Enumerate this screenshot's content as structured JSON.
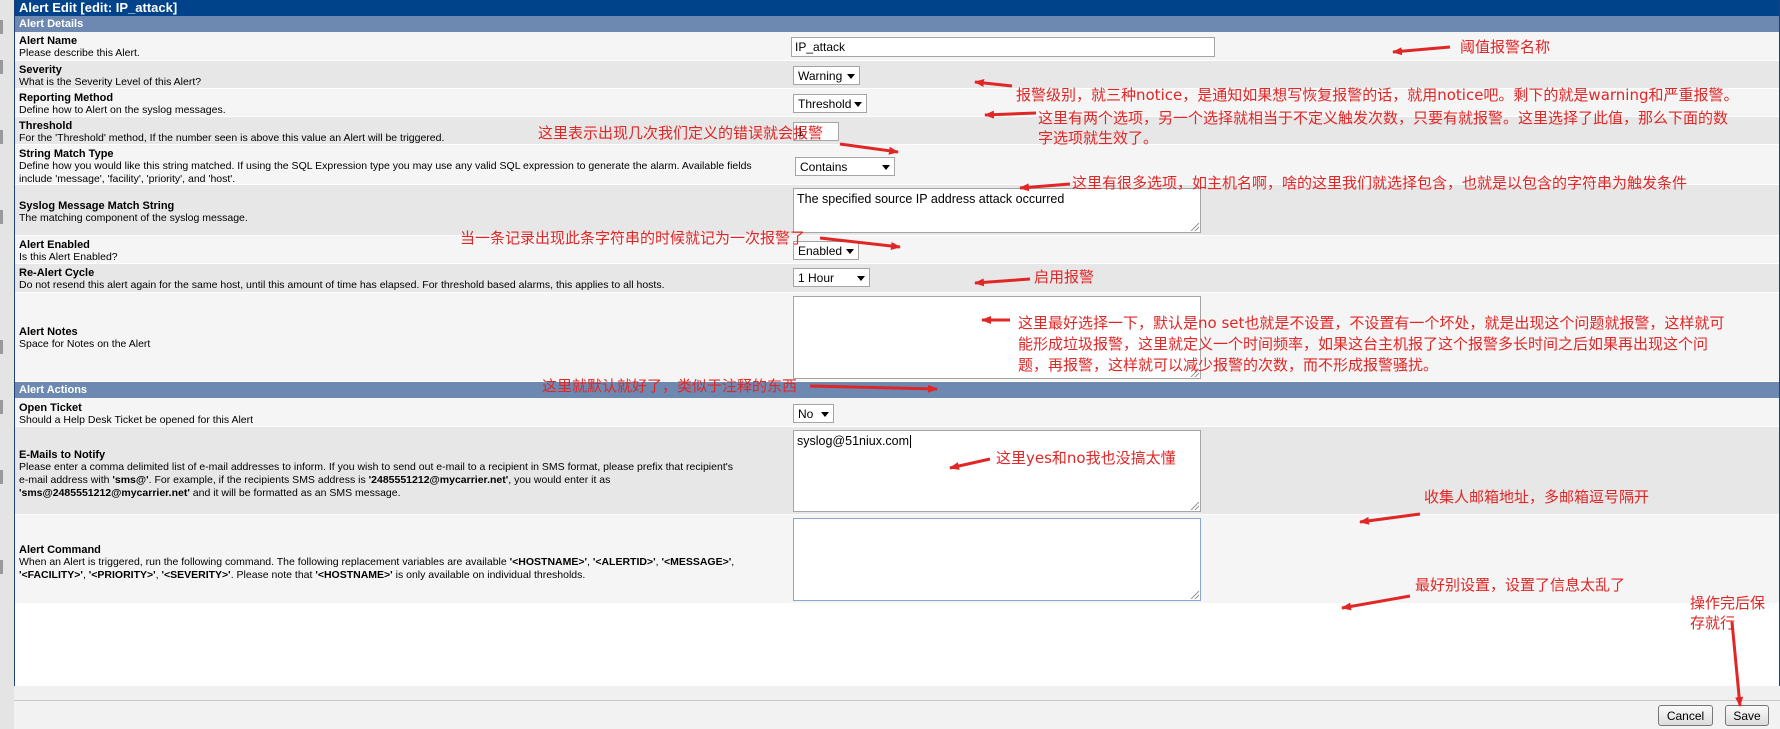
{
  "window": {
    "title": "Alert Edit [edit: IP_attack]"
  },
  "sections": {
    "details": "Alert Details",
    "actions": "Alert Actions"
  },
  "fields": {
    "alert_name": {
      "label": "Alert Name",
      "desc": "Please describe this Alert.",
      "value": "IP_attack"
    },
    "severity": {
      "label": "Severity",
      "desc": "What is the Severity Level of this Alert?",
      "value": "Warning"
    },
    "reporting": {
      "label": "Reporting Method",
      "desc": "Define how to Alert on the syslog messages.",
      "value": "Threshold"
    },
    "threshold": {
      "label": "Threshold",
      "desc": "For the 'Threshold' method, If the number seen is above this value an Alert will be triggered.",
      "value": "1"
    },
    "match_type": {
      "label": "String Match Type",
      "desc": "Define how you would like this string matched. If using the SQL Expression type you may use any valid SQL expression to generate the alarm. Available fields include 'message', 'facility', 'priority', and 'host'.",
      "value": "Contains"
    },
    "match_string": {
      "label": "Syslog Message Match String",
      "desc": "The matching component of the syslog message.",
      "value": "The specified source IP address attack occurred"
    },
    "enabled": {
      "label": "Alert Enabled",
      "desc": "Is this Alert Enabled?",
      "value": "Enabled"
    },
    "realert": {
      "label": "Re-Alert Cycle",
      "desc": "Do not resend this alert again for the same host, until this amount of time has elapsed. For threshold based alarms, this applies to all hosts.",
      "value": "1 Hour"
    },
    "notes": {
      "label": "Alert Notes",
      "desc": "Space for Notes on the Alert",
      "value": ""
    },
    "ticket": {
      "label": "Open Ticket",
      "desc": "Should a Help Desk Ticket be opened for this Alert",
      "value": "No"
    },
    "emails": {
      "label": "E-Mails to Notify",
      "desc1": "Please enter a comma delimited list of e-mail addresses to inform. If you wish to send out e-mail to a recipient in SMS format, please prefix that recipient's",
      "desc2a": "e-mail address with ",
      "desc2b": "'sms@'",
      "desc2c": ". For example, if the recipients SMS address is ",
      "desc2d": "'2485551212@mycarrier.net'",
      "desc2e": ", you would enter it as",
      "desc3a": "'sms@2485551212@mycarrier.net'",
      "desc3b": " and it will be formatted as an SMS message.",
      "value": "syslog@51niux.com"
    },
    "command": {
      "label": "Alert Command",
      "desc1a": "When an Alert is triggered, run the following command. The following replacement variables are available ",
      "desc1b": "'<HOSTNAME>'",
      "desc1c": ", ",
      "desc1d": "'<ALERTID>'",
      "desc1e": ", ",
      "desc1f": "'<MESSAGE>'",
      "desc1g": ",",
      "desc2a": "'<FACILITY>'",
      "desc2b": ", ",
      "desc2c": "'<PRIORITY>'",
      "desc2d": ", ",
      "desc2e": "'<SEVERITY>'",
      "desc2f": ". Please note that ",
      "desc2g": "'<HOSTNAME>'",
      "desc2h": " is only available on individual thresholds.",
      "value": ""
    }
  },
  "annotations": {
    "a1": "阈值报警名称",
    "a2": "报警级别，就三种notice，是通知如果想写恢复报警的话，就用notice吧。剩下的就是warning和严重报警。",
    "a3_1": "这里有两个选项，另一个选择就相当于不定义触发次数，只要有就报警。这里选择了此值，那么下面的数",
    "a3_2": "字选项就生效了。",
    "a4": "这里表示出现几次我们定义的错误就会报警",
    "a5": "这里有很多选项，如主机名啊，啥的这里我们就选择包含，也就是以包含的字符串为触发条件",
    "a6": "当一条记录出现此条字符串的时候就记为一次报警了",
    "a7": "启用报警",
    "a8_1": "这里最好选择一下，默认是no set也就是不设置，不设置有一个坏处，就是出现这个问题就报警，这样就可",
    "a8_2": "能形成垃圾报警，这里就定义一个时间频率，如果这台主机报了这个报警多长时间之后如果再出现这个问",
    "a8_3": "题，再报警，这样就可以减少报警的次数，而不形成报警骚扰。",
    "a9": "这里就默认就好了，类似于注释的东西",
    "a10": "这里yes和no我也没搞太懂",
    "a11": "收集人邮箱地址，多邮箱逗号隔开",
    "a12": "最好别设置，设置了信息太乱了",
    "a13_1": "操作完后保",
    "a13_2": "存就行"
  },
  "buttons": {
    "cancel": "Cancel",
    "save": "Save"
  },
  "colors": {
    "title_bar": "#00438a",
    "section_bar": "#6d89b1",
    "annotation": "#e12626"
  }
}
